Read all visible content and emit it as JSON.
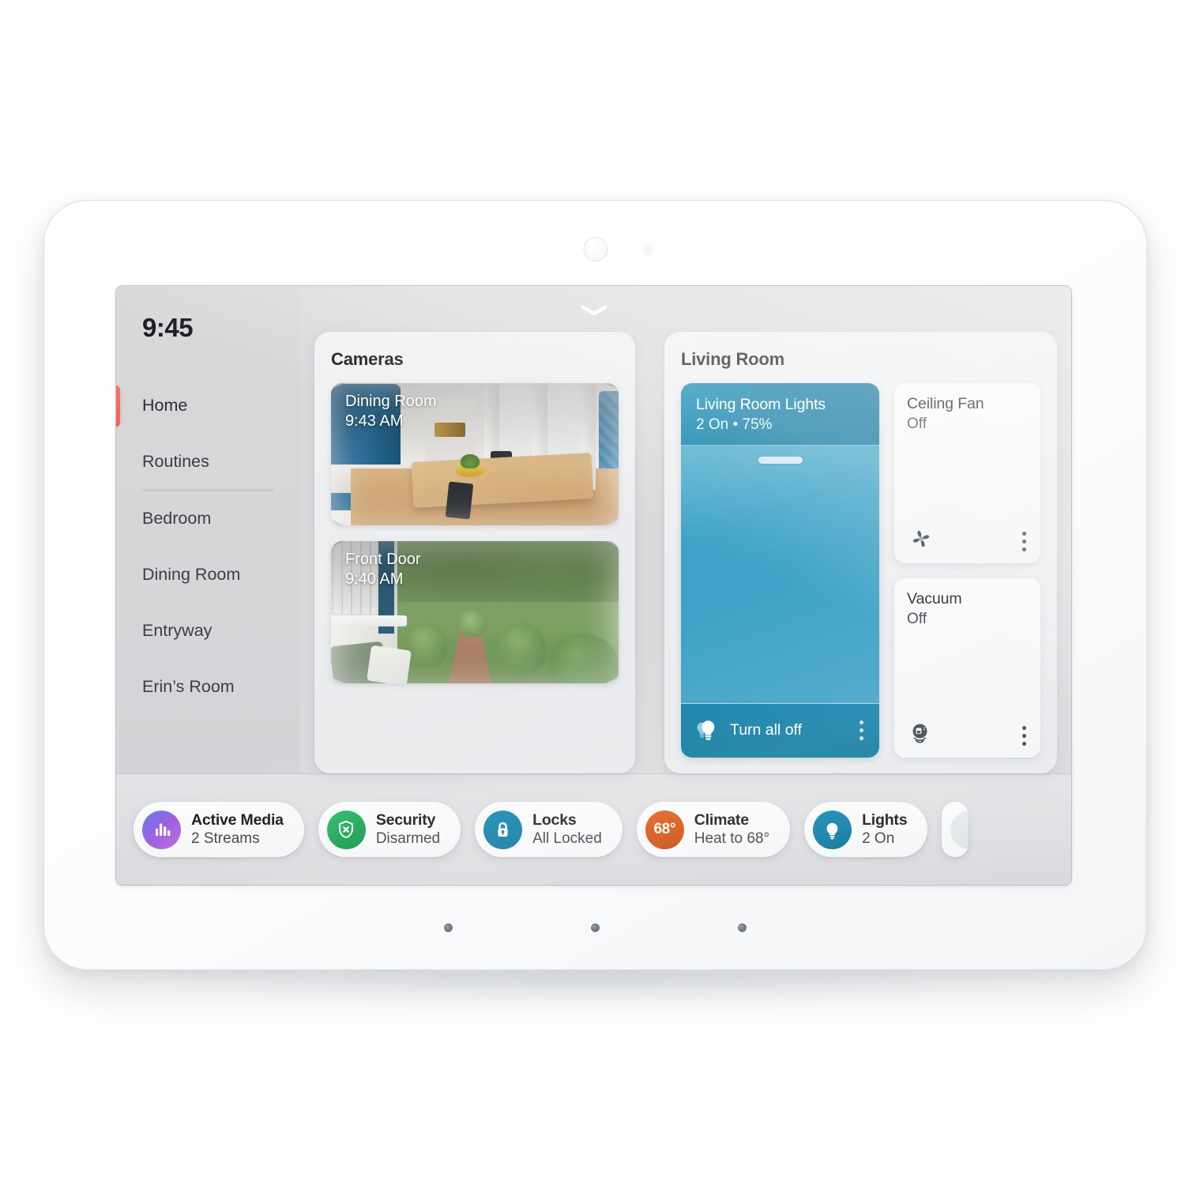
{
  "device": {
    "name": "smart-display",
    "camera_lens": "camera-lens"
  },
  "screen": {
    "clock": "9:45",
    "pulldown_hint": "chevron-down-icon"
  },
  "sidebar": {
    "items": [
      {
        "label": "Home",
        "active": true
      },
      {
        "label": "Routines",
        "active": false
      },
      {
        "label": "Bedroom",
        "active": false
      },
      {
        "label": "Dining Room",
        "active": false
      },
      {
        "label": "Entryway",
        "active": false
      },
      {
        "label": "Erin’s Room",
        "active": false
      }
    ]
  },
  "cameras_card": {
    "title": "Cameras",
    "feeds": [
      {
        "name": "Dining Room",
        "time": "9:43 AM"
      },
      {
        "name": "Front Door",
        "time": "9:40 AM"
      }
    ]
  },
  "living_room_card": {
    "title": "Living Room",
    "lights": {
      "name": "Living Room Lights",
      "status": "2 On • 75%",
      "brightness_percent": 75,
      "action_label": "Turn all off",
      "action_icon": "lightbulb-icon",
      "menu_icon": "kebab-menu-icon",
      "accent": "#0b7ba4",
      "slider_fill": "#3ba0c4"
    },
    "devices": [
      {
        "name": "Ceiling Fan",
        "state": "Off",
        "icon": "ceiling-fan-icon",
        "menu_icon": "kebab-menu-icon"
      },
      {
        "name": "Vacuum",
        "state": "Off",
        "icon": "robot-vacuum-icon",
        "menu_icon": "kebab-menu-icon"
      }
    ]
  },
  "status_bar": {
    "pills": [
      {
        "title": "Active Media",
        "sub": "2 Streams",
        "icon": "equalizer-icon",
        "color": "#8b5cf6"
      },
      {
        "title": "Security",
        "sub": "Disarmed",
        "icon": "shield-x-icon",
        "color": "#18a558"
      },
      {
        "title": "Locks",
        "sub": "All Locked",
        "icon": "lock-icon",
        "color": "#0b7ba4"
      },
      {
        "title": "Climate",
        "sub": "Heat to 68°",
        "icon": "temperature-badge",
        "badge_text": "68°",
        "color": "#d4500f"
      },
      {
        "title": "Lights",
        "sub": "2 On",
        "icon": "lightbulb-icon",
        "color": "#0b7ba4"
      }
    ],
    "overflow_pill": "partial-pill"
  }
}
